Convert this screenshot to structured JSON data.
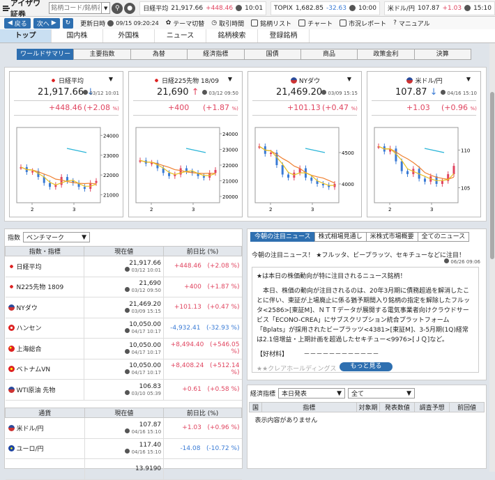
{
  "app": {
    "name": "アイザワ証券"
  },
  "search": {
    "placeholder": "銘柄コード/銘柄名"
  },
  "tickers": [
    {
      "name": "日経平均",
      "value": "21,917.66",
      "change": "+448.46",
      "time": "10:01",
      "dir": "pos"
    },
    {
      "name": "TOPIX",
      "value": "1,682.85",
      "change": "-32.63",
      "time": "10:00",
      "dir": "neg"
    },
    {
      "name": "米ドル/円",
      "value": "107.87",
      "change": "+1.03",
      "time": "15:10",
      "dir": "pos"
    }
  ],
  "toolbar": {
    "back": "戻る",
    "forward": "次へ",
    "refresh": "更新日時",
    "refresh_time": "09/15 09:20:24",
    "items": [
      "テーマ切替",
      "取引時間",
      "銘柄リスト",
      "チャート",
      "市況レポート",
      "マニュアル"
    ]
  },
  "main_tabs": [
    "トップ",
    "国内株",
    "外国株",
    "ニュース",
    "銘柄検索",
    "登録銘柄"
  ],
  "sub_tabs": [
    "ワールドサマリー",
    "主要指数",
    "為替",
    "経済指標",
    "国債",
    "商品",
    "政策金利",
    "決算"
  ],
  "cards": [
    {
      "name": "日経平均",
      "flag": "jp",
      "price": "21,917.66",
      "arrow": "↓",
      "arrow_dir": "neg",
      "time": "03/12 10:01",
      "change": "+448.46",
      "pct": "(+2.08",
      "pct_unit": "%)",
      "yticks": [
        "24000",
        "23000",
        "22000",
        "21000"
      ],
      "xticks": [
        "2",
        "3"
      ]
    },
    {
      "name": "日経225先物 18/09",
      "flag": "jp",
      "price": "21,690",
      "arrow": "↑",
      "arrow_dir": "pos",
      "time": "03/12 09:50",
      "change": "+400",
      "pct": "(+1.87",
      "pct_unit": "%)",
      "yticks": [
        "24000",
        "23000",
        "22000",
        "21000",
        "20000"
      ],
      "xticks": [
        "2",
        "3"
      ]
    },
    {
      "name": "NYダウ",
      "flag": "us",
      "price": "21,469.20",
      "arrow": "",
      "arrow_dir": "pos",
      "time": "03/09 15:15",
      "change": "+101.13",
      "pct": "(+0.47",
      "pct_unit": "%)",
      "yticks": [
        "4500",
        "4000"
      ],
      "xticks": [
        "2",
        "3"
      ]
    },
    {
      "name": "米ドル/円",
      "flag": "us",
      "price": "107.87",
      "arrow": "↓",
      "arrow_dir": "neg",
      "time": "04/16 15:10",
      "change": "+1.03",
      "pct": "(+0.96",
      "pct_unit": "%)",
      "yticks": [
        "110",
        "105"
      ],
      "xticks": [
        "2",
        "3"
      ]
    }
  ],
  "index_panel": {
    "label": "指数",
    "select": "ベンチマーク",
    "headers": [
      "指数・指標",
      "現在値",
      "前日比 (%)"
    ],
    "rows": [
      {
        "name": "日経平均",
        "flag": "jp",
        "value": "21,917.66",
        "time": "03/12 10:01",
        "change": "+448.46",
        "pct": "(+2.08 %)",
        "dir": "pos"
      },
      {
        "name": "N225先物 1809",
        "flag": "jp",
        "value": "21,690",
        "time": "03/12 09:50",
        "change": "+400",
        "pct": "(+1.87 %)",
        "dir": "pos"
      },
      {
        "name": "NYダウ",
        "flag": "us",
        "value": "21,469.20",
        "time": "03/09 15:15",
        "change": "+101.13",
        "pct": "(+0.47 %)",
        "dir": "pos"
      },
      {
        "name": "ハンセン",
        "flag": "hk",
        "value": "10,050.00",
        "time": "04/17 10:17",
        "change": "-4,932.41",
        "pct": "(-32.93 %)",
        "dir": "neg"
      },
      {
        "name": "上海総合",
        "flag": "cn",
        "value": "10,050.00",
        "time": "04/17 10:17",
        "change": "+8,494.40",
        "pct": "(+546.05 %)",
        "dir": "pos"
      },
      {
        "name": "ベトナムVN",
        "flag": "vn",
        "value": "10,050.00",
        "time": "04/17 10:17",
        "change": "+8,408.24",
        "pct": "(+512.14 %)",
        "dir": "pos"
      },
      {
        "name": "WTI原油 先物",
        "flag": "us",
        "value": "106.83",
        "time": "03/10 05:39",
        "change": "+0.61",
        "pct": "(+0.58 %)",
        "dir": "pos"
      }
    ],
    "fx_headers": [
      "通貨",
      "現在値",
      "前日比 (%)"
    ],
    "fx_rows": [
      {
        "name": "米ドル/円",
        "flag": "us",
        "value": "107.87",
        "time": "04/16 15:10",
        "change": "+1.03",
        "pct": "(+0.96 %)",
        "dir": "pos"
      },
      {
        "name": "ユーロ/円",
        "flag": "eu",
        "value": "117.40",
        "time": "04/16 15:10",
        "change": "-14.08",
        "pct": "(-10.72 %)",
        "dir": "neg"
      },
      {
        "name": "",
        "flag": "",
        "value": "13.9190",
        "time": "",
        "change": "",
        "pct": "",
        "dir": "pos"
      }
    ]
  },
  "news": {
    "tabs": [
      "今朝の注目ニュース",
      "株式相場見通し",
      "米株式市場概要",
      "全てのニュース"
    ],
    "headline": "今朝の注目ニュース！ ★フルッタ、ビープラッツ、セキチューなどに注目！",
    "time": "06/26 09:06",
    "paragraphs": [
      "★は本日の株価動向が特に注目されるニュース銘柄！",
      "　本日、株価の動向が注目されるのは、20年3月期に債務超過を解消したことに伴い、東証が上場廃止に係る猶予期間入り銘柄の指定を解除したフルッタ<2586>[東証M]、ＮＴＴデータが展開する電気事業者向けクラウドサービス「ECONO-CREA」にサブスクリプション統合プラットフォーム「Bplats」が採用されたビープラッツ<4381>[東証M]、3-5月期(1Q)経常は2.1倍増益・上期計画を超過したセキチュー<9976>[ＪＱ]など。",
      "【好材料】　　　－－－－－－－－－－－－",
      "★★クレアホールディングス"
    ],
    "more": "もっと見る"
  },
  "econ": {
    "label": "経済指標",
    "select1": "本日発表",
    "select2": "全て",
    "headers": [
      "国",
      "指標",
      "対象期",
      "発表数値",
      "調査予想",
      "前回値"
    ],
    "empty": "表示内容がありません"
  },
  "chart_data": [
    {
      "type": "line",
      "title": "日経平均",
      "series": [
        {
          "name": "",
          "values": [
            22400,
            22150,
            22200,
            21900,
            21600,
            21400,
            21500,
            21900,
            21700,
            21600,
            21400,
            21300,
            21600,
            21700
          ]
        }
      ],
      "ylim": [
        20600,
        24400
      ],
      "xticks": [
        "2",
        "3"
      ]
    },
    {
      "type": "line",
      "title": "日経225先物 18/09",
      "series": [
        {
          "name": "",
          "values": [
            22300,
            22100,
            22150,
            21800,
            21500,
            21300,
            21400,
            21800,
            21600,
            21500,
            21300,
            21200,
            21500,
            21690
          ]
        }
      ],
      "ylim": [
        19600,
        24400
      ],
      "xticks": [
        "2",
        "3"
      ]
    },
    {
      "type": "line",
      "title": "NYダウ",
      "series": [
        {
          "name": "",
          "values": [
            4600,
            4480,
            4500,
            4300,
            4150,
            4100,
            4180,
            4250,
            4100,
            4050,
            4000,
            3980,
            3950,
            4000
          ]
        }
      ],
      "ylim": [
        3700,
        4900
      ],
      "xticks": [
        "2",
        "3"
      ]
    },
    {
      "type": "line",
      "title": "米ドル/円",
      "series": [
        {
          "name": "",
          "values": [
            110.5,
            109.8,
            110.2,
            108.5,
            107.2,
            106.8,
            107.5,
            106.2,
            105.8,
            106.5,
            105.5,
            105.9,
            106.8,
            107.9
          ]
        }
      ],
      "ylim": [
        103,
        113
      ],
      "xticks": [
        "2",
        "3"
      ]
    }
  ]
}
